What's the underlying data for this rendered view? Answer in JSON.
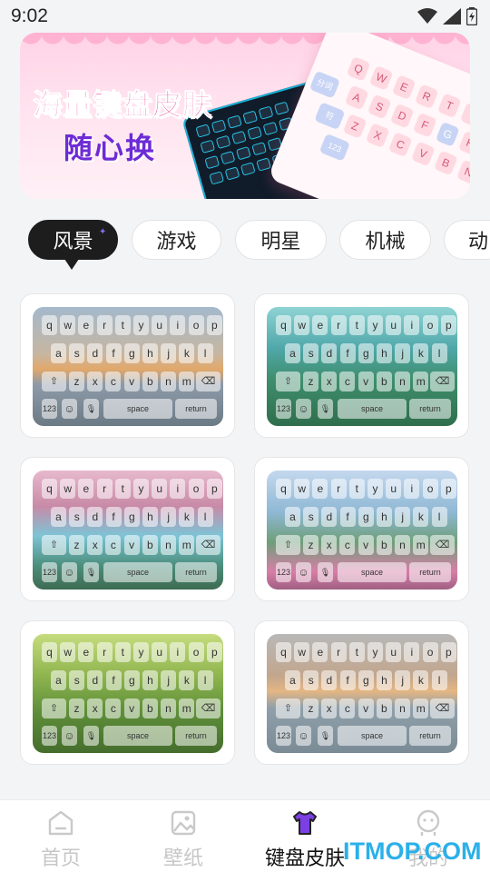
{
  "status": {
    "time": "9:02"
  },
  "banner": {
    "title_line1": "海量键盘皮肤",
    "title_line2": "随心换",
    "pink_keys": [
      "Q",
      "W",
      "E",
      "R",
      "T",
      "Y",
      "A",
      "S",
      "D",
      "F",
      "G",
      "H",
      "Z",
      "X",
      "C",
      "V",
      "B",
      "N"
    ],
    "pink_special": [
      "分词",
      "符",
      "123"
    ]
  },
  "tabs": [
    {
      "label": "风景",
      "active": true
    },
    {
      "label": "游戏",
      "active": false
    },
    {
      "label": "明星",
      "active": false
    },
    {
      "label": "机械",
      "active": false
    },
    {
      "label": "动",
      "active": false
    }
  ],
  "keyboard": {
    "row1": [
      "q",
      "w",
      "e",
      "r",
      "t",
      "y",
      "u",
      "i",
      "o",
      "p"
    ],
    "row2": [
      "a",
      "s",
      "d",
      "f",
      "g",
      "h",
      "j",
      "k",
      "l"
    ],
    "row3": [
      "z",
      "x",
      "c",
      "v",
      "b",
      "n",
      "m"
    ],
    "num": "123",
    "space": "space",
    "return": "return"
  },
  "skins": [
    {
      "name": "sunset-lake",
      "theme": "bg-sunset"
    },
    {
      "name": "big-tree",
      "theme": "bg-tree"
    },
    {
      "name": "pink-waterfall",
      "theme": "bg-fall"
    },
    {
      "name": "flower-lake",
      "theme": "bg-lake"
    },
    {
      "name": "green-plants",
      "theme": "bg-plant"
    },
    {
      "name": "river-dusk",
      "theme": "bg-river"
    }
  ],
  "nav": [
    {
      "label": "首页",
      "icon": "home-icon",
      "active": false
    },
    {
      "label": "壁纸",
      "icon": "image-icon",
      "active": false
    },
    {
      "label": "键盘皮肤",
      "icon": "tshirt-icon",
      "active": true
    },
    {
      "label": "我的",
      "icon": "user-icon",
      "active": false
    }
  ],
  "watermark": "ITMOP.COM",
  "colors": {
    "accent": "#7b3fe4",
    "active_tab": "#1d1d1d",
    "watermark": "#2bb0e8"
  }
}
